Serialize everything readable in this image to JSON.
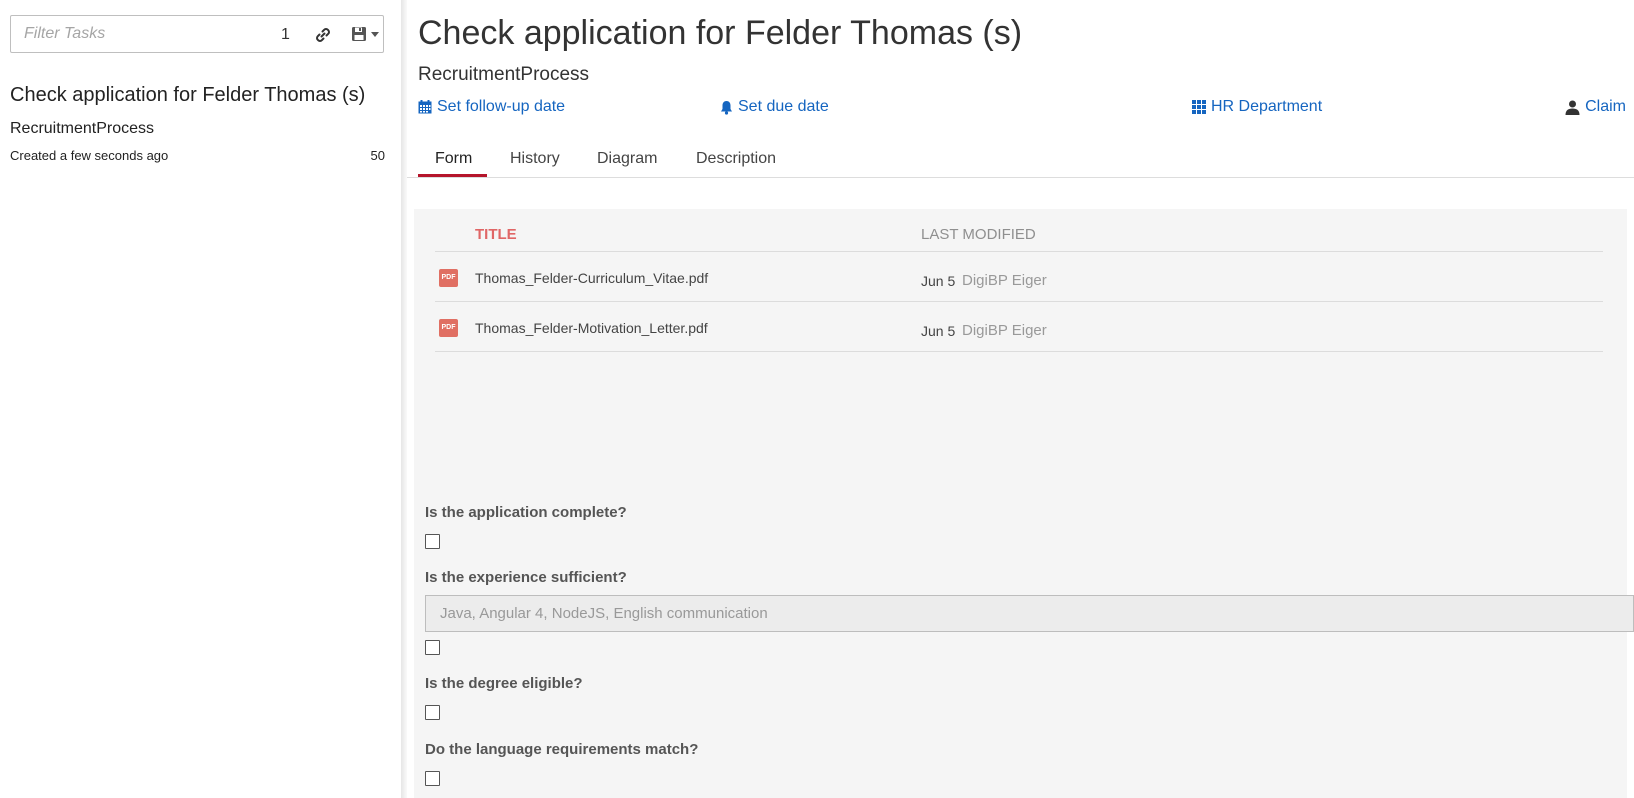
{
  "filter": {
    "placeholder": "Filter Tasks",
    "count": "1",
    "icons": [
      "link-icon",
      "save-icon",
      "caret-down-icon"
    ]
  },
  "task_list": [
    {
      "title": "Check application for Felder Thomas (s)",
      "process": "RecruitmentProcess",
      "created": "Created a few seconds ago",
      "priority": "50"
    }
  ],
  "task": {
    "title": "Check application for Felder Thomas (s)",
    "process": "RecruitmentProcess",
    "actions": {
      "follow_up": "Set follow-up date",
      "due_date": "Set due date",
      "group": "HR Department",
      "claim": "Claim"
    }
  },
  "tabs": [
    "Form",
    "History",
    "Diagram",
    "Description"
  ],
  "active_tab": "Form",
  "documents": {
    "columns": [
      "TITLE",
      "LAST MODIFIED"
    ],
    "rows": [
      {
        "icon": "PDF",
        "name": "Thomas_Felder-Curriculum_Vitae.pdf",
        "date": "Jun 5",
        "user": "DigiBP Eiger"
      },
      {
        "icon": "PDF",
        "name": "Thomas_Felder-Motivation_Letter.pdf",
        "date": "Jun 5",
        "user": "DigiBP Eiger"
      }
    ]
  },
  "form": {
    "q_complete": "Is the application complete?",
    "q_experience": "Is the experience sufficient?",
    "experience_value": "Java, Angular 4, NodeJS, English communication",
    "q_degree": "Is the degree eligible?",
    "q_language": "Do the language requirements match?"
  },
  "colors": {
    "link": "#1565c0",
    "tab_active": "#b5152b",
    "title_header": "#e06666",
    "pdf": "#e06f63"
  }
}
